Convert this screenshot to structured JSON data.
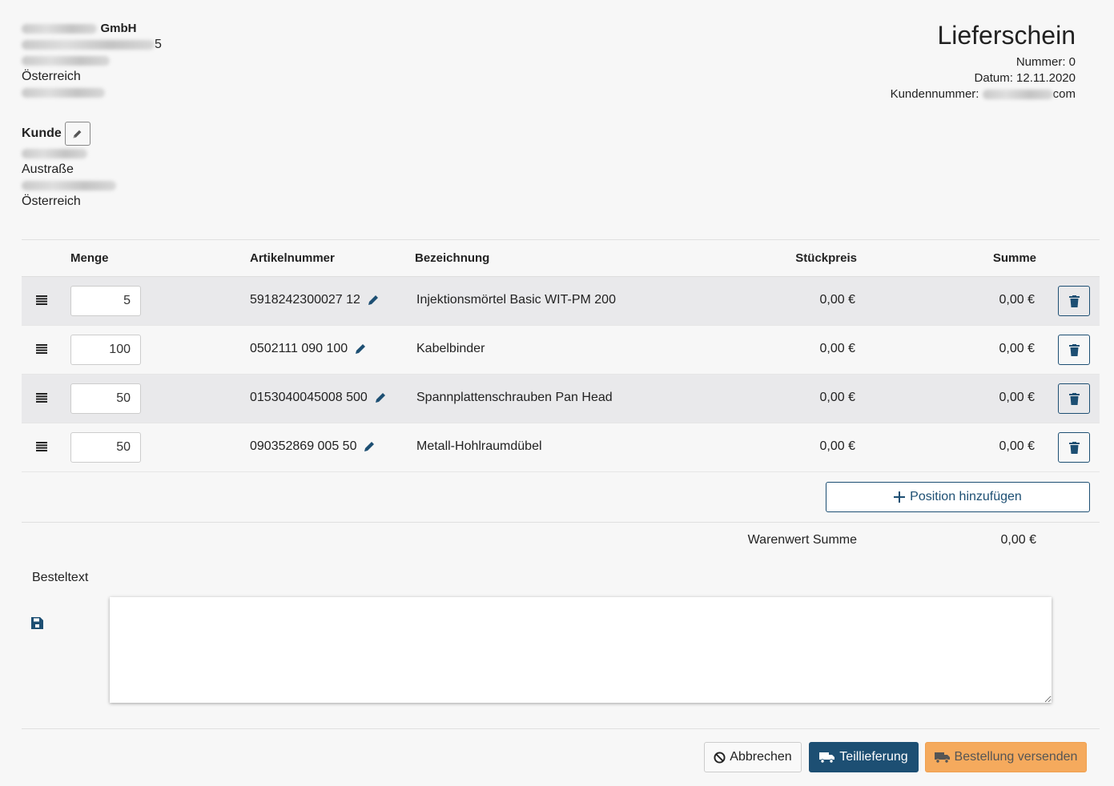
{
  "company": {
    "name_suffix": "GmbH",
    "address_line2_suffix": "5",
    "country": "Österreich"
  },
  "document": {
    "title": "Lieferschein",
    "number": "Nummer: 0",
    "date": "Datum: 12.11.2020",
    "customer_number_label": "Kundennummer:",
    "customer_number_suffix": "com"
  },
  "customer": {
    "label": "Kunde",
    "street": "Austraße",
    "country": "Österreich"
  },
  "table": {
    "headers": {
      "qty": "Menge",
      "article": "Artikelnummer",
      "description": "Bezeichnung",
      "unit_price": "Stückpreis",
      "sum": "Summe"
    },
    "rows": [
      {
        "qty": "5",
        "article": "5918242300027 12",
        "description": "Injektionsmörtel Basic WIT-PM 200",
        "unit_price": "0,00 €",
        "sum": "0,00 €"
      },
      {
        "qty": "100",
        "article": "0502111 090 100",
        "description": "Kabelbinder",
        "unit_price": "0,00 €",
        "sum": "0,00 €"
      },
      {
        "qty": "50",
        "article": "0153040045008 500",
        "description": "Spannplattenschrauben Pan Head",
        "unit_price": "0,00 €",
        "sum": "0,00 €"
      },
      {
        "qty": "50",
        "article": "090352869 005 50",
        "description": "Metall-Hohlraumdübel",
        "unit_price": "0,00 €",
        "sum": "0,00 €"
      }
    ],
    "add_position_label": "Position hinzufügen",
    "total_label": "Warenwert Summe",
    "total_value": "0,00 €"
  },
  "order_text": {
    "label": "Besteltext",
    "value": ""
  },
  "actions": {
    "cancel": "Abbrechen",
    "partial": "Teillieferung",
    "send": "Bestellung versenden"
  },
  "colors": {
    "primary": "#1d4f73",
    "accent": "#f5aa5d",
    "row_stripe": "#e9e9eb"
  }
}
